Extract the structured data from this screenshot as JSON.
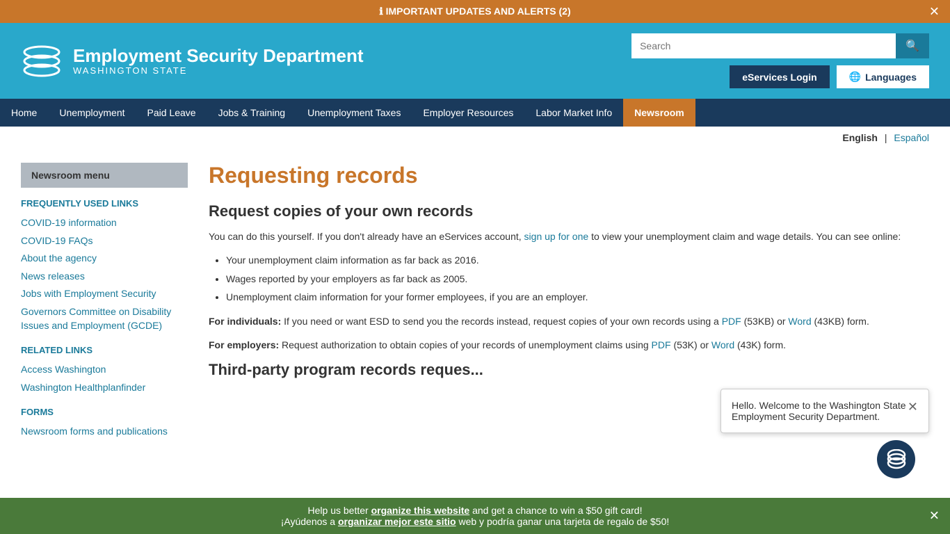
{
  "alert": {
    "text": "IMPORTANT UPDATES AND ALERTS (2)"
  },
  "header": {
    "logo_line1": "Employment Security Department",
    "logo_line2": "WASHINGTON STATE",
    "search_placeholder": "Search",
    "eservices_label": "eServices Login",
    "languages_label": "Languages"
  },
  "nav": {
    "items": [
      {
        "label": "Home",
        "active": false
      },
      {
        "label": "Unemployment",
        "active": false
      },
      {
        "label": "Paid Leave",
        "active": false
      },
      {
        "label": "Jobs & Training",
        "active": false
      },
      {
        "label": "Unemployment Taxes",
        "active": false
      },
      {
        "label": "Employer Resources",
        "active": false
      },
      {
        "label": "Labor Market Info",
        "active": false
      },
      {
        "label": "Newsroom",
        "active": true
      }
    ]
  },
  "lang": {
    "english": "English",
    "espanol": "Español"
  },
  "sidebar": {
    "menu_title": "Newsroom menu",
    "frequently_used_label": "FREQUENTLY USED LINKS",
    "frequently_used_links": [
      {
        "label": "COVID-19 information"
      },
      {
        "label": "COVID-19 FAQs"
      },
      {
        "label": "About the agency"
      },
      {
        "label": "News releases"
      },
      {
        "label": "Jobs with Employment Security"
      },
      {
        "label": "Governors Committee on Disability Issues and Employment (GCDE)"
      }
    ],
    "related_label": "RELATED LINKS",
    "related_links": [
      {
        "label": "Access Washington"
      },
      {
        "label": "Washington Healthplanfinder"
      }
    ],
    "forms_label": "FORMS",
    "forms_links": [
      {
        "label": "Newsroom forms and publications"
      }
    ]
  },
  "main": {
    "page_title": "Requesting records",
    "section1_title": "Request copies of your own records",
    "section1_intro": "You can do this yourself. If you don't already have an eServices account,",
    "section1_link": "sign up for one",
    "section1_rest": "to view your unemployment claim and wage details. You can see online:",
    "section1_bullets": [
      "Your unemployment claim information as far back as 2016.",
      "Wages reported by your employers as far back as 2005.",
      "Unemployment claim information for your former employees, if you are an employer."
    ],
    "individuals_label": "For individuals:",
    "individuals_text": "If you need or want ESD to send you the records instead, request copies of your own records using a",
    "individuals_pdf": "PDF",
    "individuals_pdf_size": "(53KB)",
    "individuals_or": "or",
    "individuals_word": "Word",
    "individuals_word_size": "(43KB)",
    "individuals_form": "form.",
    "employers_label": "For employers:",
    "employers_text": "Request authorization to obtain copies of your records of unemployment claims using",
    "employers_pdf": "PDF",
    "employers_pdf_size": "(53K)",
    "employers_or": "or",
    "employers_word": "Word",
    "employers_word_size": "(43K)",
    "employers_form": "form.",
    "section2_title": "Third-party program records reques..."
  },
  "chat": {
    "message": "Hello. Welcome to the Washington State Employment Security Department."
  },
  "promo": {
    "line1": "Help us better organize this website and get a chance to win a $50 gift card!",
    "line2": "¡Ayúdenos a organizar mejor este sitio web y podría ganar una tarjeta de regalo de $50!"
  }
}
